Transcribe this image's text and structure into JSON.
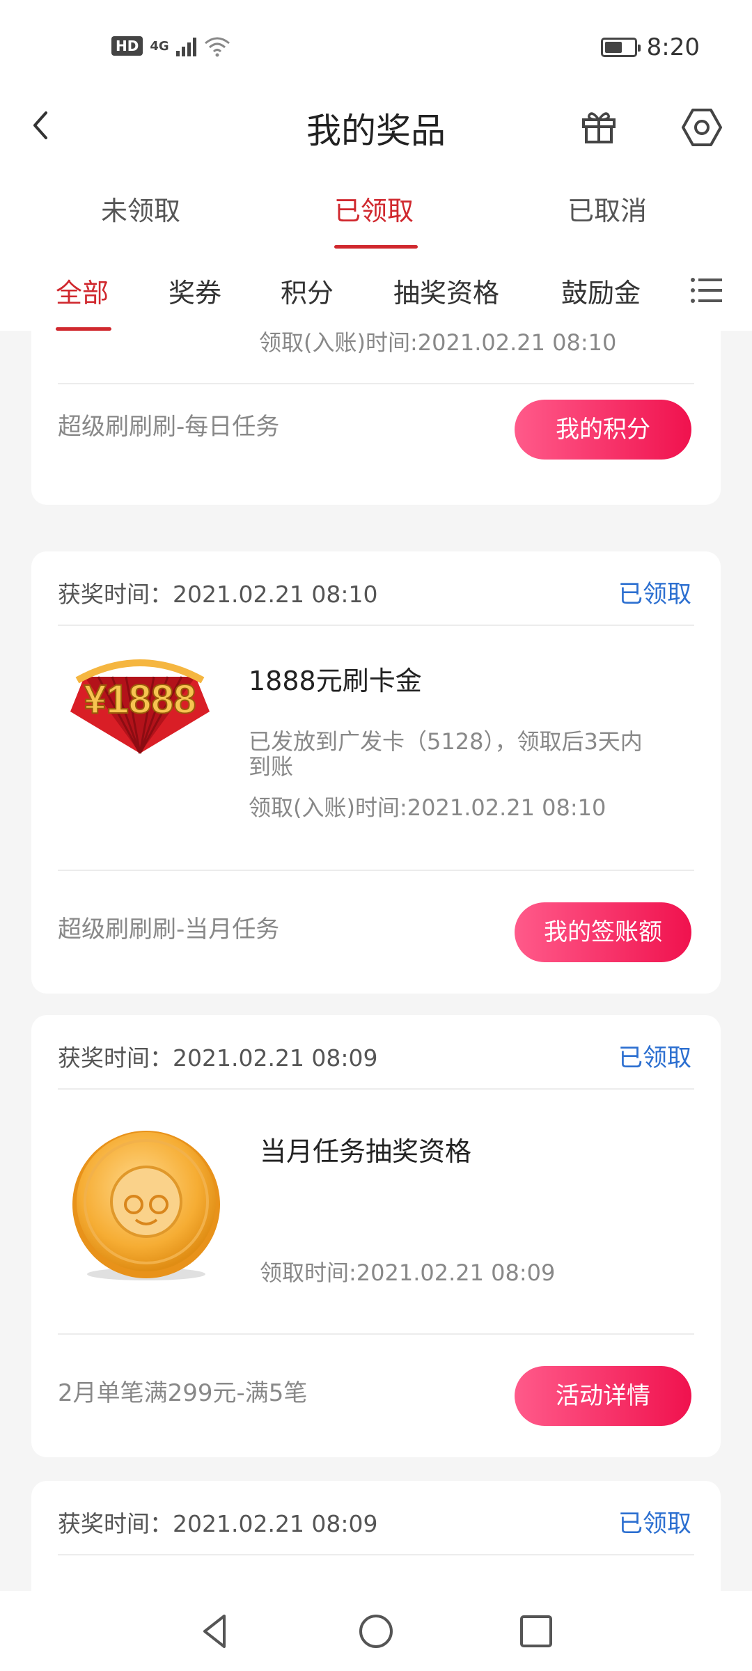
{
  "status_bar": {
    "hd": "HD",
    "network": "4G",
    "time": "8:20",
    "battery_level": 0.6
  },
  "header": {
    "title": "我的奖品",
    "back_icon": "chevron-left-icon",
    "gift_icon": "gift-icon",
    "settings_icon": "hexagon-settings-icon"
  },
  "tabs": [
    {
      "label": "未领取",
      "active": false
    },
    {
      "label": "已领取",
      "active": true
    },
    {
      "label": "已取消",
      "active": false
    }
  ],
  "categories": [
    {
      "label": "全部",
      "active": true
    },
    {
      "label": "奖券",
      "active": false
    },
    {
      "label": "积分",
      "active": false
    },
    {
      "label": "抽奖资格",
      "active": false
    },
    {
      "label": "鼓励金",
      "active": false
    }
  ],
  "cards": [
    {
      "prize_time": "领取(入账)时间:2021.02.21 08:10",
      "source": "超级刷刷刷-每日任务",
      "button": "我的积分"
    },
    {
      "won_time": "获奖时间：2021.02.21 08:10",
      "status": "已领取",
      "image_text": "¥1888",
      "prize_name": "1888元刷卡金",
      "desc_line1": "已发放到广发卡（5128），领取后3天内",
      "desc_line2": "到账",
      "prize_time": "领取(入账)时间:2021.02.21 08:10",
      "source": "超级刷刷刷-当月任务",
      "button": "我的签账额"
    },
    {
      "won_time": "获奖时间：2021.02.21 08:09",
      "status": "已领取",
      "prize_name": "当月任务抽奖资格",
      "prize_time": "领取时间:2021.02.21 08:09",
      "source": "2月单笔满299元-满5笔",
      "button": "活动详情"
    },
    {
      "won_time": "获奖时间：2021.02.21 08:09",
      "status": "已领取"
    }
  ],
  "colors": {
    "accent": "#d0282e",
    "status_blue": "#2c6fd0",
    "pill_start": "#ff5a8a",
    "pill_end": "#f0124e"
  }
}
